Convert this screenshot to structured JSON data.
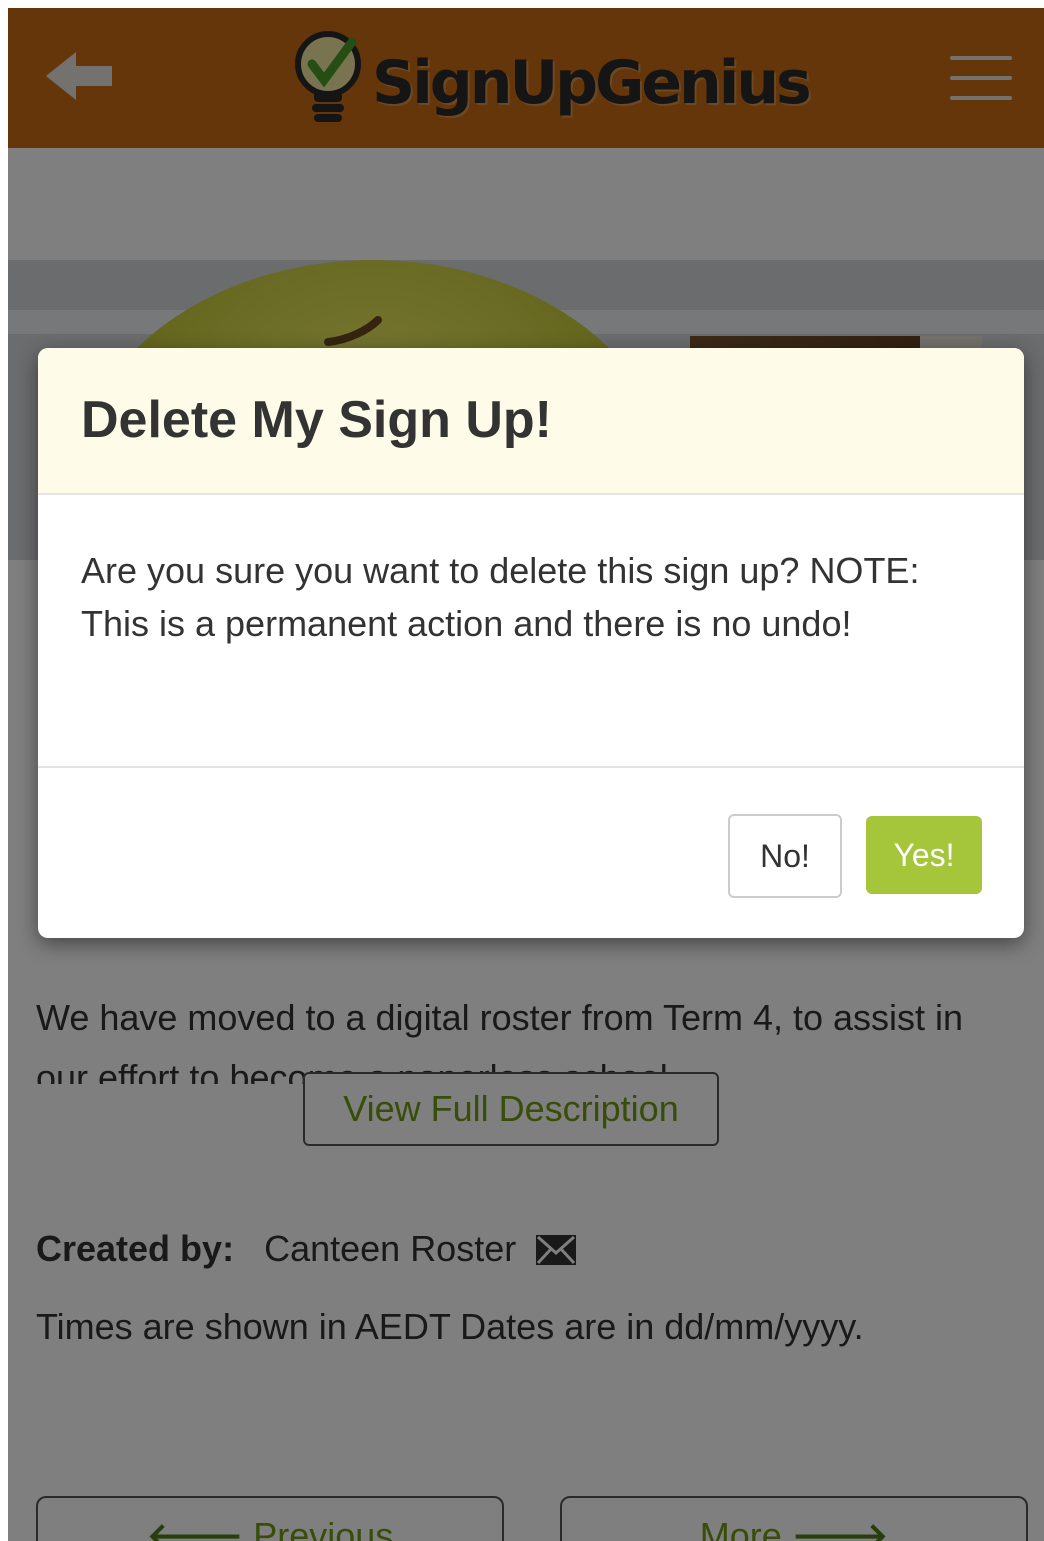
{
  "header": {
    "logo_text": "SignUpGenius",
    "back_icon": "arrow-left-icon",
    "menu_icon": "hamburger-menu-icon",
    "bar_color": "#c86d12"
  },
  "page": {
    "description": "We have moved to a digital roster from Term 4, to assist in our effort to become a paperless school",
    "view_full_label": "View Full Description",
    "created_by_label": "Created by:",
    "created_by_name": "Canteen Roster",
    "mail_icon": "envelope-icon",
    "times_note": "Times are shown in AEDT Dates are in dd/mm/yyyy.",
    "prev_label": "Previous",
    "more_label": "More"
  },
  "modal": {
    "title": "Delete My Sign Up!",
    "body": "Are you sure you want to delete this sign up? NOTE: This is a permanent action and there is no undo!",
    "no_label": "No!",
    "yes_label": "Yes!",
    "yes_color": "#a5c53a",
    "header_bg": "#fefbe8"
  }
}
